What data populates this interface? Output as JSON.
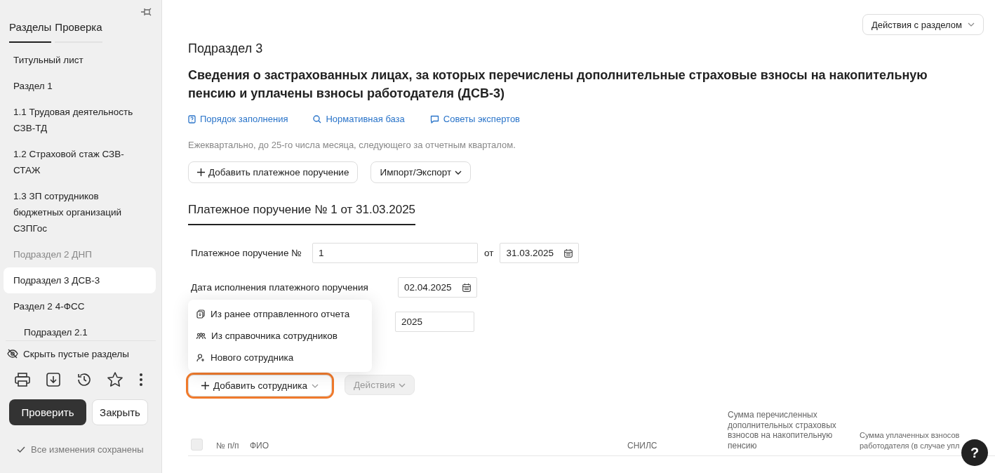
{
  "sidebar": {
    "tabs": [
      {
        "label": "Разделы",
        "selected": true
      },
      {
        "label": "Проверка",
        "selected": false
      }
    ],
    "items": [
      {
        "label": "Титульный лист",
        "selected": false,
        "empty": false
      },
      {
        "label": "Раздел 1",
        "selected": false,
        "empty": false
      },
      {
        "label": "1.1 Трудовая деятельность СЗВ-ТД",
        "selected": false,
        "empty": false
      },
      {
        "label": "1.2 Страховой стаж СЗВ-СТАЖ",
        "selected": false,
        "empty": false
      },
      {
        "label": "1.3 ЗП сотрудников бюджетных организаций СЗПГос",
        "selected": false,
        "empty": false
      },
      {
        "label": "Подраздел 2 ДНП",
        "selected": false,
        "empty": true
      },
      {
        "label": "Подраздел 3 ДСВ-3",
        "selected": true,
        "empty": false
      },
      {
        "label": "Раздел 2 4-ФСС",
        "selected": false,
        "empty": false,
        "children": [
          {
            "label": "Подраздел 2.1",
            "selected": false,
            "empty": false
          }
        ]
      }
    ],
    "hide_empty": "Скрыть пустые разделы",
    "check_button": "Проверить",
    "close_button": "Закрыть",
    "save_status": "Все изменения сохранены"
  },
  "main": {
    "section_actions": "Действия с разделом",
    "subtitle": "Подраздел 3",
    "title": "Сведения о застрахованных лицах, за которых перечислены дополнительные страховые взносы на накопительную пенсию и уплачены взносы работодателя (ДСВ-3)",
    "links": [
      {
        "label": "Порядок заполнения",
        "kind": "guide"
      },
      {
        "label": "Нормативная база",
        "kind": "search"
      },
      {
        "label": "Советы экспертов",
        "kind": "chat"
      }
    ],
    "deadline_note": "Ежеквартально, до 25-го числа месяца, следующего за отчетным кварталом.",
    "toolbar": [
      {
        "label": "Добавить платежное поручение",
        "kind": "add"
      },
      {
        "label": "Импорт/Экспорт",
        "kind": "dropdown"
      }
    ],
    "payment_tabs": [
      {
        "label": "Платежное поручение № 1 от 31.03.2025",
        "selected": true
      }
    ],
    "form": {
      "order_number": {
        "label": "Платежное поручение №",
        "value": "1"
      },
      "order_date": {
        "label": "от",
        "value": "31.03.2025"
      },
      "execution_date": {
        "label": "Дата исполнения платежного поручения",
        "value": "02.04.2025"
      },
      "field_3": {
        "value": "2025"
      }
    },
    "add_employee": {
      "label": "Добавить сотрудника",
      "focused": true,
      "expanded": true,
      "menu": [
        {
          "label": "Из ранее отправленного отчета",
          "kind": "report"
        },
        {
          "label": "Из справочника сотрудников",
          "kind": "directory"
        },
        {
          "label": "Нового сотрудника",
          "kind": "new"
        }
      ]
    },
    "actions_button": {
      "label": "Действия",
      "disabled": true
    },
    "table": {
      "select_all": {
        "checked": false
      },
      "columns": [
        "№ п/п",
        "ФИО",
        "СНИЛС",
        "Сумма перечисленных дополнительных страховых взносов на накопительную пенсию",
        "Сумма уплаченных взносов работодателя (в случае упл"
      ]
    },
    "help_button": "?"
  }
}
